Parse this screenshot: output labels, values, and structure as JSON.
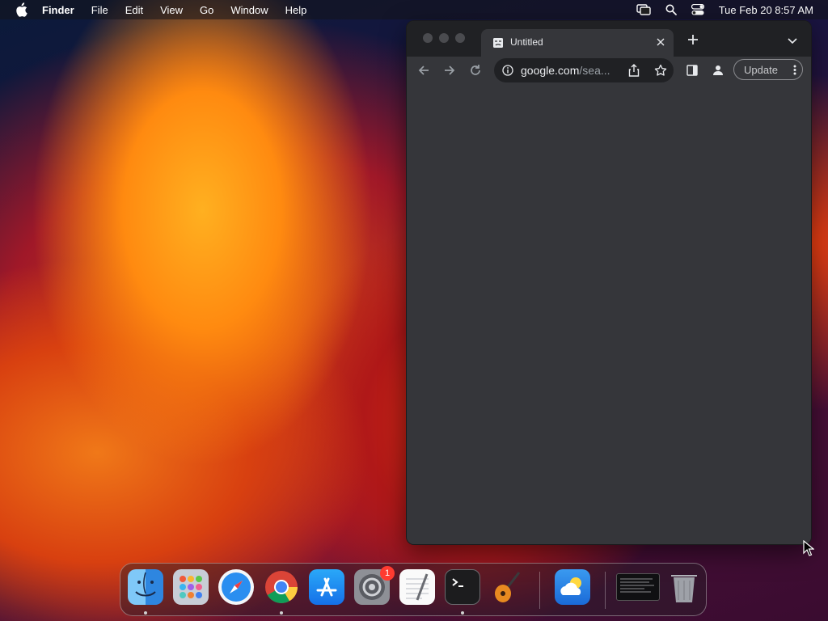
{
  "menubar": {
    "app_name": "Finder",
    "items": [
      "File",
      "Edit",
      "View",
      "Go",
      "Window",
      "Help"
    ],
    "clock": "Tue Feb 20  8:57 AM"
  },
  "browser": {
    "tab_title": "Untitled",
    "url_host": "google.com",
    "url_rest": "/sea...",
    "update_label": "Update"
  },
  "dock": {
    "apps": [
      "Finder",
      "Launchpad",
      "Safari",
      "Google Chrome",
      "App Store",
      "System Settings",
      "TextEdit",
      "Terminal",
      "GarageBand",
      "Weather",
      "Window Preview",
      "Trash"
    ],
    "settings_badge": "1"
  },
  "colors": {
    "window_bg": "#35363a",
    "tabstrip_bg": "#202124",
    "badge": "#ff3b30"
  }
}
